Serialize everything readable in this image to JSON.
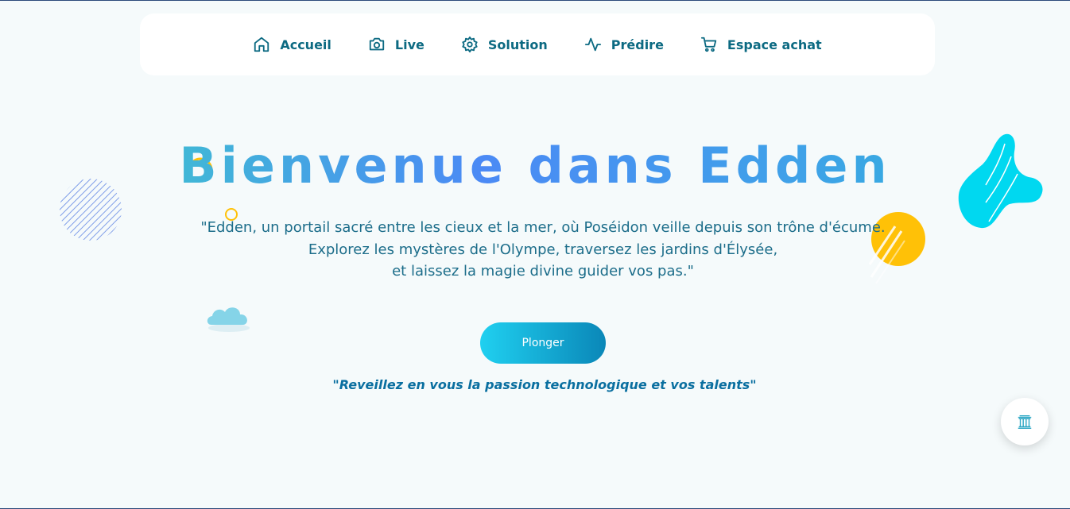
{
  "nav": {
    "items": [
      {
        "label": "Accueil",
        "icon": "home-icon"
      },
      {
        "label": "Live",
        "icon": "camera-icon"
      },
      {
        "label": "Solution",
        "icon": "gear-icon"
      },
      {
        "label": "Prédire",
        "icon": "activity-icon"
      },
      {
        "label": "Espace achat",
        "icon": "cart-icon"
      }
    ]
  },
  "hero": {
    "title": "Bienvenue dans Edden",
    "intro_line1": "\"Edden, un portail sacré entre les cieux et la mer, où Poséidon veille depuis son trône d'écume.",
    "intro_line2": "Explorez les mystères de l'Olympe, traversez les jardins d'Élysée,",
    "intro_line3": "et laissez la magie divine guider vos pas.\"",
    "cta_label": "Plonger",
    "tagline": "\"Reveillez en vous la passion technologique et vos talents\""
  },
  "colors": {
    "accent": "#0c6a82",
    "title_gradient": [
      "#3ad2c4",
      "#4b8af5",
      "#2bb6d6"
    ],
    "yellow": "#ffc107",
    "cyan": "#00d8f0"
  },
  "floating_button": {
    "icon": "temple-icon"
  }
}
